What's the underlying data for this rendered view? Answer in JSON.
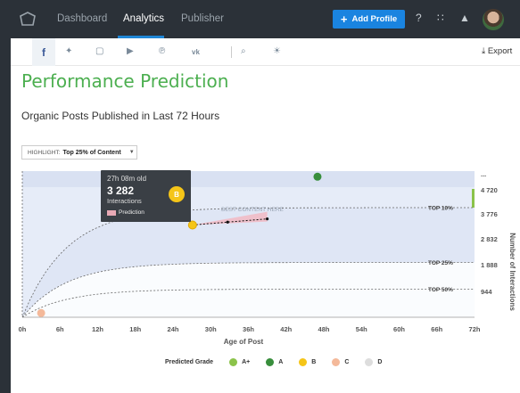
{
  "nav": {
    "items": [
      "Dashboard",
      "Analytics",
      "Publisher"
    ],
    "active": "Analytics",
    "add_profile_label": "Add Profile"
  },
  "social_tabs": [
    "facebook-icon",
    "twitter-icon",
    "instagram-icon",
    "youtube-icon",
    "pinterest-icon",
    "vk-icon",
    "search-icon",
    "bulb-icon"
  ],
  "export_label": "Export",
  "page_title": "Performance Prediction",
  "subtitle": "Organic Posts Published in Last 72 Hours",
  "highlight": {
    "prefix": "HIGHLIGHT:",
    "value": "Top 25% of Content"
  },
  "tooltip": {
    "age": "27h 08m old",
    "value": "3 282",
    "unit": "Interactions",
    "prediction_label": "Prediction",
    "grade": "B"
  },
  "chart_data": {
    "type": "line",
    "xlabel": "Age of Post",
    "ylabel": "Number of Interactions",
    "x_ticks": [
      "0h",
      "6h",
      "12h",
      "18h",
      "24h",
      "30h",
      "36h",
      "42h",
      "48h",
      "54h",
      "60h",
      "66h",
      "72h"
    ],
    "y_ticks": [
      "...",
      "4 720",
      "3 776",
      "2 832",
      "1 888",
      "944"
    ],
    "band_labels": [
      "TOP 10%",
      "TOP 25%",
      "TOP 50%"
    ],
    "annotation": "BEST CONTENT HERE",
    "points": [
      {
        "x_hours": 27.1,
        "y": 3282,
        "grade": "B"
      },
      {
        "x_hours": 47,
        "y": 5000,
        "grade": "A"
      },
      {
        "x_hours": 3,
        "y": 150,
        "grade": "C"
      }
    ],
    "prediction": {
      "from_hours": 27.1,
      "to_hours": 39,
      "y_start": 3282,
      "y_end": 3500
    },
    "colors": {
      "A+": "#8bc34a",
      "A": "#388e3c",
      "B": "#f5c518",
      "C": "#f4b99a",
      "D": "#dddddd"
    }
  },
  "legend": {
    "title": "Predicted Grade",
    "items": [
      "A+",
      "A",
      "B",
      "C",
      "D"
    ]
  }
}
